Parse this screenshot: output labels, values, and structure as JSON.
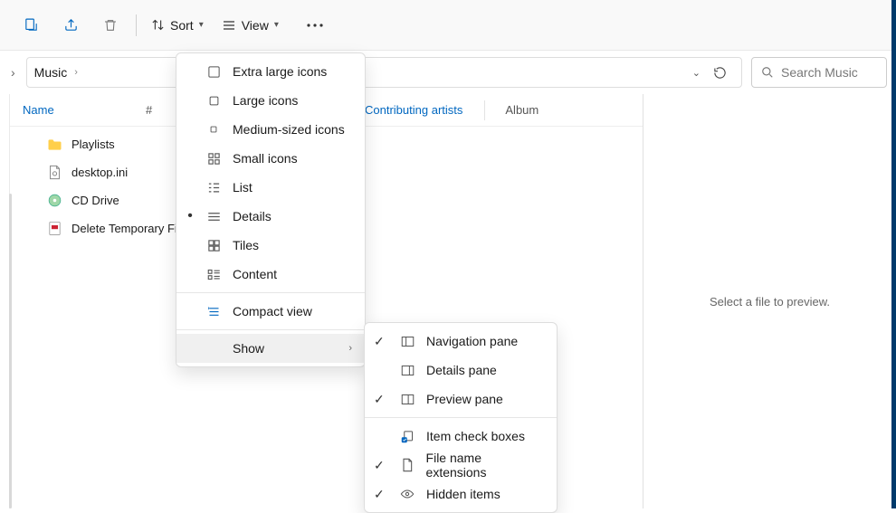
{
  "toolbar": {
    "sort_label": "Sort",
    "view_label": "View"
  },
  "breadcrumb": {
    "current": "Music"
  },
  "search": {
    "placeholder": "Search Music"
  },
  "columns": {
    "name": "Name",
    "num": "#",
    "contributing": "Contributing artists",
    "album": "Album"
  },
  "rows": [
    {
      "name": "Playlists",
      "icon": "folder"
    },
    {
      "name": "desktop.ini",
      "icon": "ini"
    },
    {
      "name": "CD Drive",
      "icon": "cd"
    },
    {
      "name": "Delete Temporary Fi...",
      "icon": "exe"
    }
  ],
  "preview": {
    "empty": "Select a file to preview."
  },
  "view_menu": {
    "items": [
      {
        "label": "Extra large icons",
        "icon": "xl"
      },
      {
        "label": "Large icons",
        "icon": "lg"
      },
      {
        "label": "Medium-sized icons",
        "icon": "md"
      },
      {
        "label": "Small icons",
        "icon": "sm"
      },
      {
        "label": "List",
        "icon": "list"
      },
      {
        "label": "Details",
        "icon": "details",
        "selected": true
      },
      {
        "label": "Tiles",
        "icon": "tiles"
      },
      {
        "label": "Content",
        "icon": "content"
      }
    ],
    "compact": "Compact view",
    "show": "Show"
  },
  "show_menu": {
    "items": [
      {
        "label": "Navigation pane",
        "checked": true
      },
      {
        "label": "Details pane",
        "checked": false
      },
      {
        "label": "Preview pane",
        "checked": true
      }
    ],
    "items2": [
      {
        "label": "Item check boxes",
        "checked": false
      },
      {
        "label": "File name extensions",
        "checked": true
      },
      {
        "label": "Hidden items",
        "checked": true
      }
    ]
  }
}
